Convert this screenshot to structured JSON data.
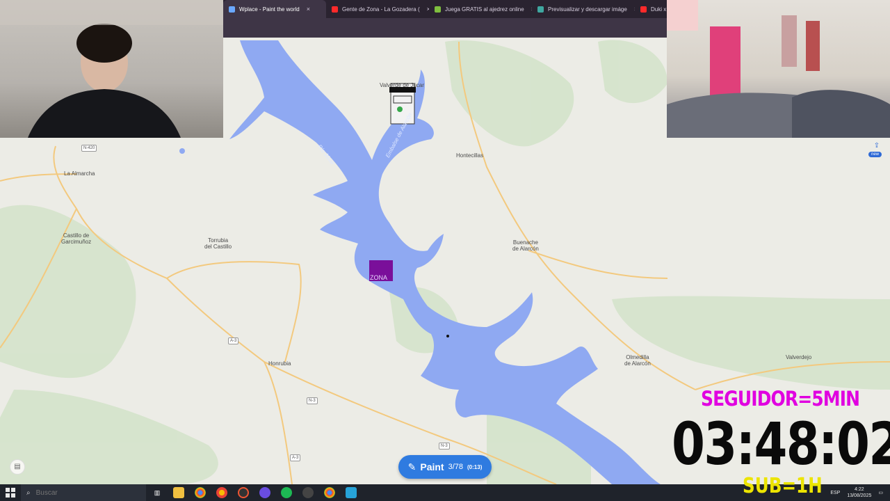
{
  "browser": {
    "tabs": [
      {
        "title": "Wplace - Paint the world",
        "favicon_color": "#6aa8ff",
        "active": true
      },
      {
        "title": "Gente de Zona - La Gozadera (",
        "favicon_color": "#ff2a2a",
        "active": false
      },
      {
        "title": "Juega GRATIS al ajedrez online",
        "favicon_color": "#7fbf3f",
        "active": false
      },
      {
        "title": "Previsualizar y descargar imáge",
        "favicon_color": "#3fa7a0",
        "active": false
      },
      {
        "title": "Duki x",
        "favicon_color": "#ff2a2a",
        "active": false
      }
    ],
    "close_glyph": "×"
  },
  "map": {
    "places": [
      {
        "name": "La Almarcha"
      },
      {
        "name": "Castillo de\nGarcimuñoz"
      },
      {
        "name": "Torrubia\ndel Castillo"
      },
      {
        "name": "Valverde de Júcar"
      },
      {
        "name": "Hontecillas"
      },
      {
        "name": "Buenache\nde Alarcón"
      },
      {
        "name": "Olmedilla\nde Alarcón"
      },
      {
        "name": "Valverdejo"
      },
      {
        "name": "Honrubia"
      }
    ],
    "roads": [
      "N-420",
      "A-3",
      "N-3",
      "N-3",
      "A-3"
    ],
    "water_labels": [
      "Río Júcar",
      "Embalse de Alarcón"
    ],
    "pixel_art_text": "ZONA",
    "water_color": "#8fa9f2",
    "land_color": "#ecece6"
  },
  "controls": {
    "share_icon": "share-icon",
    "share_badge": "new",
    "paint_label": "Paint",
    "paint_count": "3/78",
    "paint_timer": "(0:13)",
    "accent_color": "#2f7be0"
  },
  "overlay": {
    "seguidor": "SEGUIDOR=5MIN",
    "countdown": "03:48:02",
    "sub": "SUB=1H",
    "seguidor_color": "#e000e0",
    "sub_color": "#ece400"
  },
  "taskbar": {
    "search_placeholder": "Buscar",
    "language": "ESP",
    "time": "4:22",
    "date": "13/08/2025"
  }
}
